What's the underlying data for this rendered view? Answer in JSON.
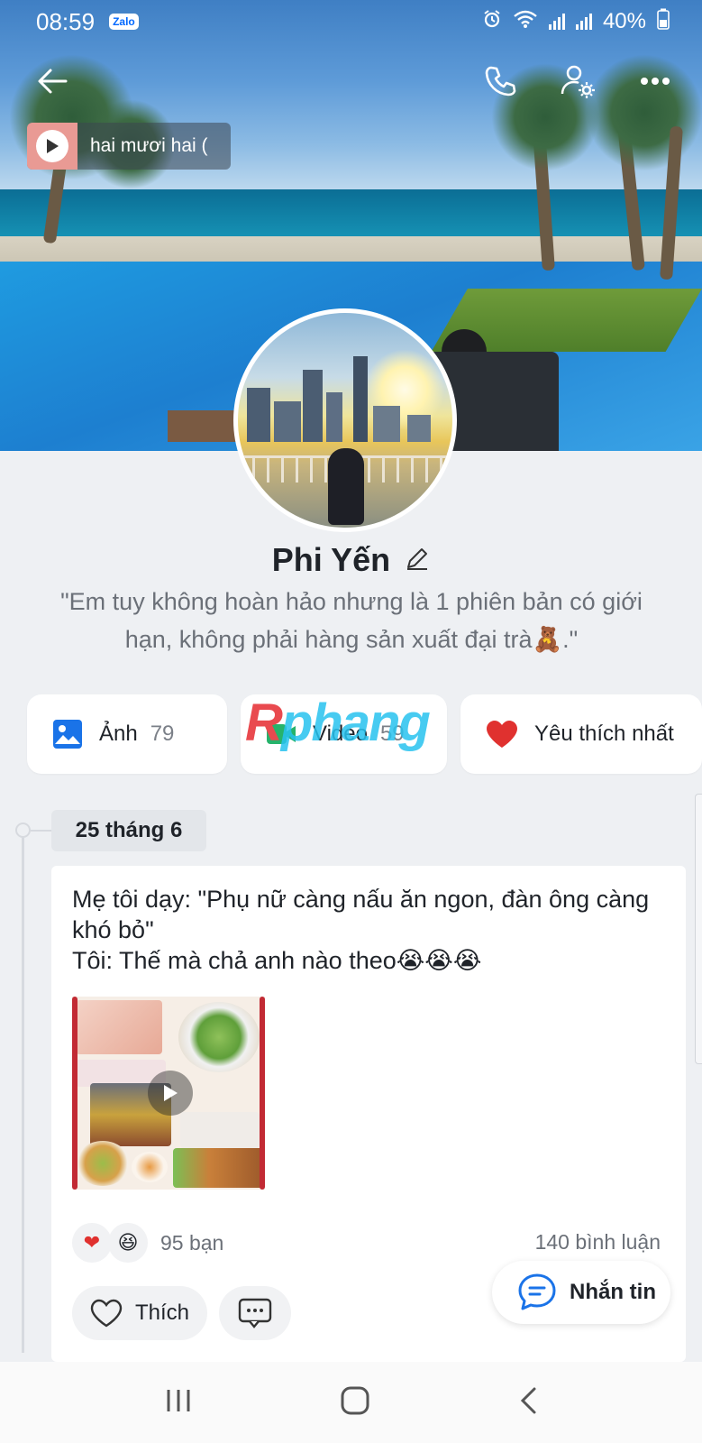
{
  "status_bar": {
    "time": "08:59",
    "app_badge": "Zalo",
    "battery": "40%"
  },
  "music": {
    "song_title": "hai mươi hai ("
  },
  "profile": {
    "name": "Phi Yến",
    "bio": "\"Em tuy không hoàn hảo nhưng là 1 phiên bản có giới hạn, không phải hàng sản xuất đại trà🧸.\""
  },
  "tiles": [
    {
      "label": "Ảnh",
      "count": "79",
      "icon": "image-icon"
    },
    {
      "label": "Video",
      "count": "59",
      "icon": "video-icon"
    },
    {
      "label": "Yêu thích nhất",
      "count": "",
      "icon": "heart-icon"
    }
  ],
  "watermark": {
    "first": "R",
    "rest": "phang"
  },
  "timeline": {
    "date": "25 tháng 6"
  },
  "post": {
    "line1": "Mẹ tôi dạy: \"Phụ nữ càng nấu ăn ngon, đàn ông càng khó bỏ\"",
    "line2": "Tôi: Thế mà chả anh nào theo😭😭😭",
    "reaction_emojis": [
      "❤",
      "😆"
    ],
    "reaction_count": "95 bạn",
    "comment_count": "140 bình luận",
    "like_label": "Thích"
  },
  "message_button": {
    "label": "Nhắn tin"
  },
  "colors": {
    "accent": "#0068ff",
    "heart": "#e0312f",
    "page_bg": "#eef0f3"
  }
}
